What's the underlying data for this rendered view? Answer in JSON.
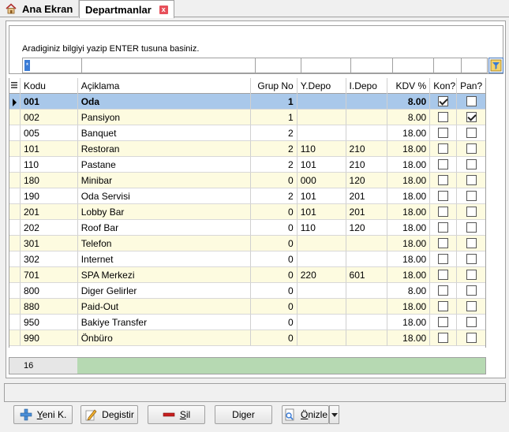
{
  "tabs": {
    "home_label": "Ana Ekran",
    "active_label": "Departmanlar",
    "close_glyph": "x"
  },
  "search": {
    "hint": "Aradiginiz bilgiyi yazip ENTER tusuna basiniz.",
    "cursor_glyph": "*",
    "filter_icon": "filter-icon"
  },
  "grid": {
    "columns": {
      "kodu": "Kodu",
      "aciklama": "Açiklama",
      "grup_no": "Grup No",
      "y_depo": "Y.Depo",
      "i_depo": "I.Depo",
      "kdv": "KDV %",
      "kon": "Kon?",
      "pan": "Pan?"
    },
    "rows": [
      {
        "kodu": "001",
        "aciklama": "Oda",
        "grup_no": "1",
        "y_depo": "",
        "i_depo": "",
        "kdv": "8.00",
        "kon": true,
        "pan": false
      },
      {
        "kodu": "002",
        "aciklama": "Pansiyon",
        "grup_no": "1",
        "y_depo": "",
        "i_depo": "",
        "kdv": "8.00",
        "kon": false,
        "pan": true
      },
      {
        "kodu": "005",
        "aciklama": "Banquet",
        "grup_no": "2",
        "y_depo": "",
        "i_depo": "",
        "kdv": "18.00",
        "kon": false,
        "pan": false
      },
      {
        "kodu": "101",
        "aciklama": "Restoran",
        "grup_no": "2",
        "y_depo": "110",
        "i_depo": "210",
        "kdv": "18.00",
        "kon": false,
        "pan": false
      },
      {
        "kodu": "110",
        "aciklama": "Pastane",
        "grup_no": "2",
        "y_depo": "101",
        "i_depo": "210",
        "kdv": "18.00",
        "kon": false,
        "pan": false
      },
      {
        "kodu": "180",
        "aciklama": "Minibar",
        "grup_no": "0",
        "y_depo": "000",
        "i_depo": "120",
        "kdv": "18.00",
        "kon": false,
        "pan": false
      },
      {
        "kodu": "190",
        "aciklama": "Oda Servisi",
        "grup_no": "2",
        "y_depo": "101",
        "i_depo": "201",
        "kdv": "18.00",
        "kon": false,
        "pan": false
      },
      {
        "kodu": "201",
        "aciklama": "Lobby Bar",
        "grup_no": "0",
        "y_depo": "101",
        "i_depo": "201",
        "kdv": "18.00",
        "kon": false,
        "pan": false
      },
      {
        "kodu": "202",
        "aciklama": "Roof Bar",
        "grup_no": "0",
        "y_depo": "110",
        "i_depo": "120",
        "kdv": "18.00",
        "kon": false,
        "pan": false
      },
      {
        "kodu": "301",
        "aciklama": "Telefon",
        "grup_no": "0",
        "y_depo": "",
        "i_depo": "",
        "kdv": "18.00",
        "kon": false,
        "pan": false
      },
      {
        "kodu": "302",
        "aciklama": "Internet",
        "grup_no": "0",
        "y_depo": "",
        "i_depo": "",
        "kdv": "18.00",
        "kon": false,
        "pan": false
      },
      {
        "kodu": "701",
        "aciklama": "SPA Merkezi",
        "grup_no": "0",
        "y_depo": "220",
        "i_depo": "601",
        "kdv": "18.00",
        "kon": false,
        "pan": false
      },
      {
        "kodu": "800",
        "aciklama": "Diger Gelirler",
        "grup_no": "0",
        "y_depo": "",
        "i_depo": "",
        "kdv": "8.00",
        "kon": false,
        "pan": false
      },
      {
        "kodu": "880",
        "aciklama": "Paid-Out",
        "grup_no": "0",
        "y_depo": "",
        "i_depo": "",
        "kdv": "18.00",
        "kon": false,
        "pan": false
      },
      {
        "kodu": "950",
        "aciklama": "Bakiye Transfer",
        "grup_no": "0",
        "y_depo": "",
        "i_depo": "",
        "kdv": "18.00",
        "kon": false,
        "pan": false
      },
      {
        "kodu": "990",
        "aciklama": "Önbüro",
        "grup_no": "0",
        "y_depo": "",
        "i_depo": "",
        "kdv": "18.00",
        "kon": false,
        "pan": false
      }
    ],
    "selected_index": 0,
    "record_count": "16"
  },
  "buttons": {
    "new_label_first": "Y",
    "new_label_rest": "eni K.",
    "edit_label": "Degistir",
    "delete_label_first": "S",
    "delete_label_rest": "il",
    "other_label": "Diger",
    "print_label_first": "Ö",
    "print_label_rest": "nizle"
  },
  "colors": {
    "selected_row": "#a9c8ea",
    "alt_row": "#fdfbe0",
    "count_bar": "#b6d9b2",
    "accent": "#3a7bd5"
  }
}
